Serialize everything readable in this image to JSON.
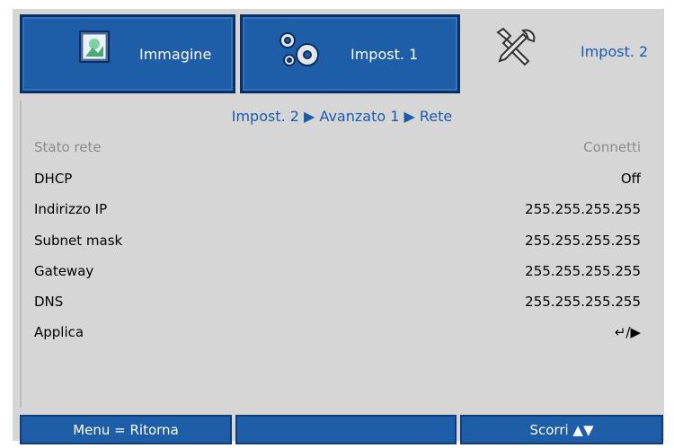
{
  "tabs": [
    {
      "label": "Immagine",
      "icon": "picture-icon"
    },
    {
      "label": "Impost. 1",
      "icon": "gears-icon"
    },
    {
      "label": "Impost. 2",
      "icon": "tools-icon"
    }
  ],
  "breadcrumb": "Impost. 2 ▶ Avanzato 1 ▶ Rete",
  "rows": [
    {
      "label": "Stato rete",
      "value": "Connetti"
    },
    {
      "label": "DHCP",
      "value": "Off"
    },
    {
      "label": "Indirizzo IP",
      "value": "255.255.255.255"
    },
    {
      "label": "Subnet mask",
      "value": "255.255.255.255"
    },
    {
      "label": "Gateway",
      "value": "255.255.255.255"
    },
    {
      "label": "DNS",
      "value": "255.255.255.255"
    },
    {
      "label": "Applica",
      "value": "↵/▶"
    }
  ],
  "footer": {
    "left": "Menu = Ritorna",
    "center": "",
    "right": "Scorri ▲▼"
  },
  "colors": {
    "accent": "#1e5ea8",
    "panel": "#d6d6d6",
    "link_text": "#1a5cab",
    "disabled_text": "#8c8c8c"
  }
}
